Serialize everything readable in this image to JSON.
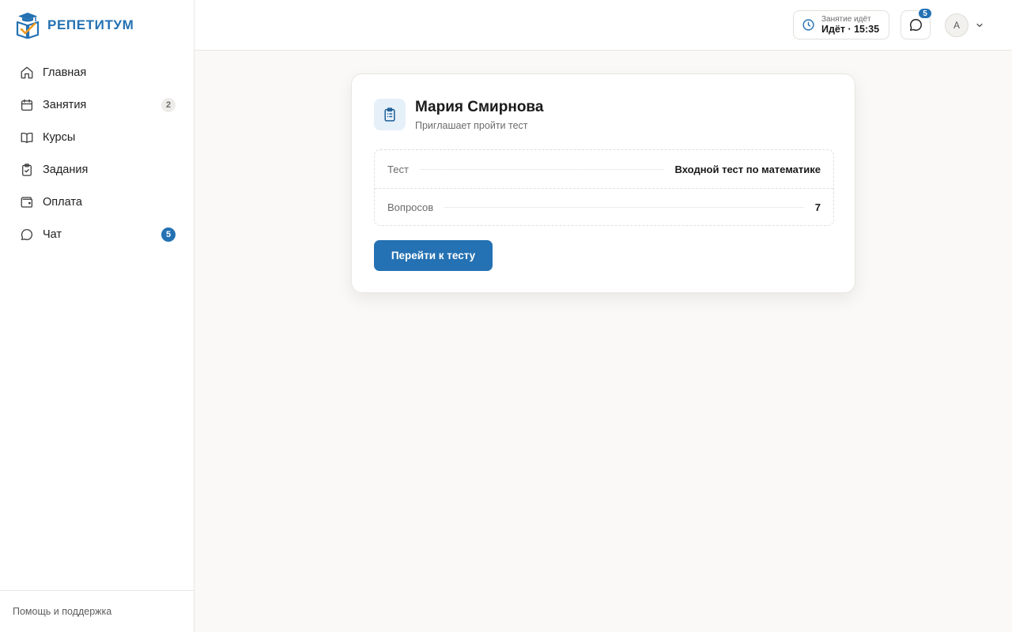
{
  "brand": {
    "name": "РЕПЕТИТУМ"
  },
  "sidebar": {
    "items": [
      {
        "label": "Главная",
        "icon": "home-icon"
      },
      {
        "label": "Занятия",
        "icon": "calendar-icon",
        "badge": "2"
      },
      {
        "label": "Курсы",
        "icon": "book-icon"
      },
      {
        "label": "Задания",
        "icon": "clipboard-check-icon"
      },
      {
        "label": "Оплата",
        "icon": "wallet-icon"
      },
      {
        "label": "Чат",
        "icon": "chat-icon",
        "badge": "5"
      }
    ],
    "footer_link": "Помощь и поддержка"
  },
  "topbar": {
    "lesson_caption": "Занятие идёт",
    "lesson_value": "Идёт · 15:35",
    "chat_count": "5",
    "avatar_initial": "A"
  },
  "card": {
    "title": "Мария Смирнова",
    "subtitle": "Приглашает пройти тест",
    "rows": [
      {
        "label": "Тест",
        "value": "Входной тест по математике"
      },
      {
        "label": "Вопросов",
        "value": "7"
      }
    ],
    "button_label": "Перейти к тесту"
  },
  "colors": {
    "accent": "#2471b3",
    "accent_light": "#e6f0f9",
    "background": "#faf9f7",
    "logo_orange": "#f39a1e"
  }
}
